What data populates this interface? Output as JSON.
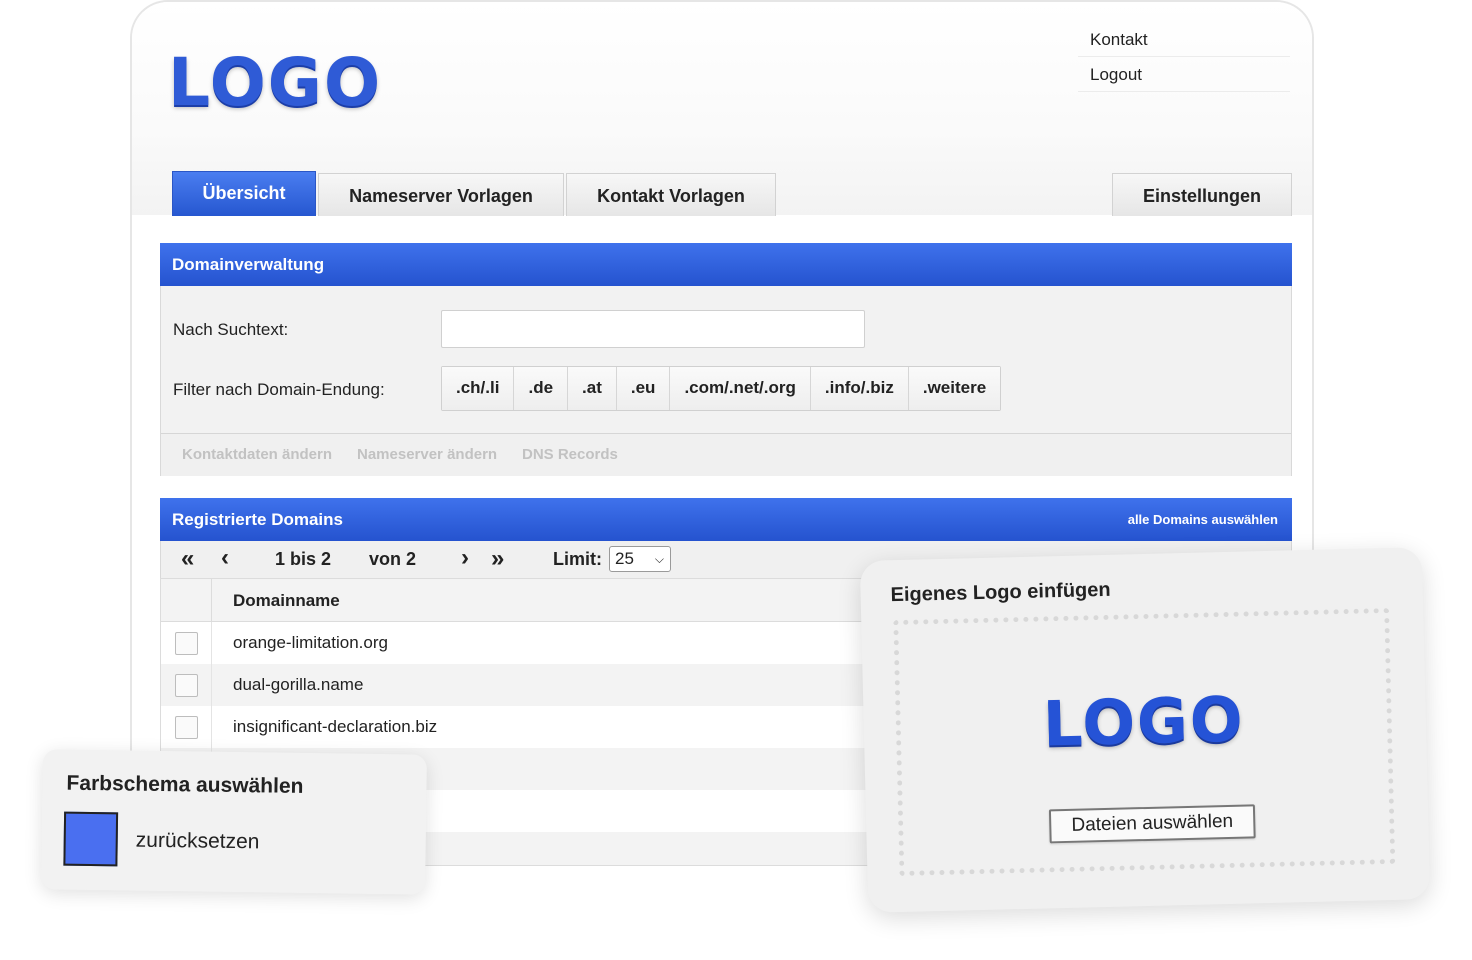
{
  "header": {
    "logo": "LOGO",
    "links": [
      "Kontakt",
      "Logout"
    ]
  },
  "tabs": [
    {
      "label": "Übersicht",
      "active": true
    },
    {
      "label": "Nameserver Vorlagen",
      "active": false
    },
    {
      "label": "Kontakt Vorlagen",
      "active": false
    },
    {
      "label": "Einstellungen",
      "active": false
    }
  ],
  "domain_panel": {
    "title": "Domainverwaltung",
    "search_label": "Nach Suchtext:",
    "search_value": "",
    "filter_label": "Filter nach Domain-Endung:",
    "filters": [
      ".ch/.li",
      ".de",
      ".at",
      ".eu",
      ".com/.net/.org",
      ".info/.biz",
      ".weitere"
    ],
    "actions": [
      "Kontaktdaten ändern",
      "Nameserver ändern",
      "DNS Records"
    ]
  },
  "registered": {
    "title": "Registrierte Domains",
    "select_all": "alle Domains auswählen",
    "pager": {
      "first": "«",
      "prev": "‹",
      "range": "1 bis 2",
      "of": "von 2",
      "next": "›",
      "last": "»",
      "limit_label": "Limit:",
      "limit_value": "25"
    },
    "column_header": "Domainname",
    "rows": [
      "orange-limitation.org",
      "dual-gorilla.name",
      "insignificant-declaration.biz"
    ]
  },
  "color_card": {
    "title": "Farbschema auswählen",
    "swatch_color": "#4a6ff0",
    "reset_label": "zurücksetzen"
  },
  "logo_card": {
    "title": "Eigenes Logo einfügen",
    "logo": "LOGO",
    "button_label": "Dateien auswählen"
  },
  "colors": {
    "accent": "#2f5bd6",
    "panel_header": "#3061dd"
  }
}
